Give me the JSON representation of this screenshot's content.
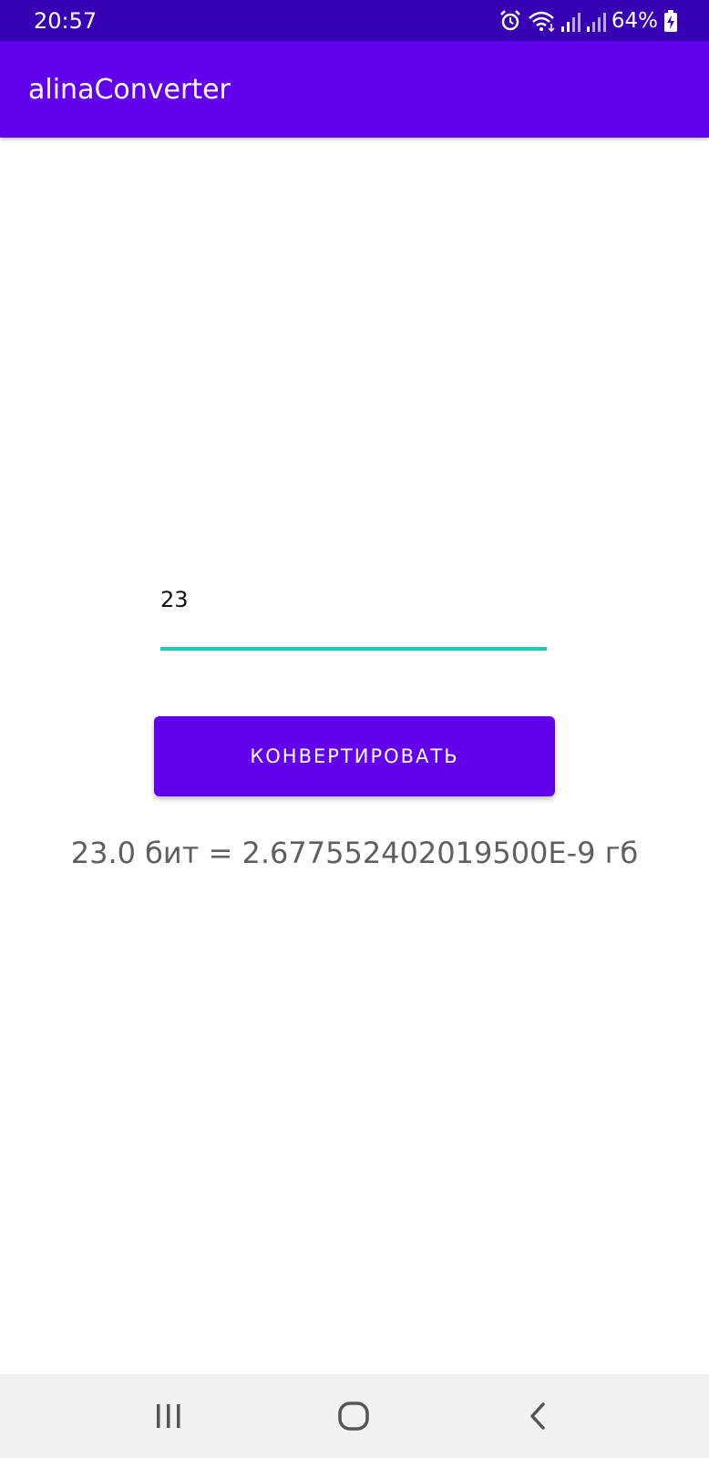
{
  "status_bar": {
    "time": "20:57",
    "battery": "64%",
    "icons": [
      "alarm-icon",
      "wifi-icon",
      "signal-icon",
      "signal-icon",
      "battery-charging-icon"
    ]
  },
  "app_bar": {
    "title": "alinaConverter"
  },
  "main": {
    "input_value": "23",
    "convert_label": "КОНВЕРТИРОВАТЬ",
    "result": "23.0 бит = 2.677552402019500Е-9 гб"
  },
  "nav_bar": {
    "icons": [
      "recent-apps-icon",
      "home-icon",
      "back-icon"
    ]
  },
  "colors": {
    "status_bar": "#3700b3",
    "primary": "#6200ee",
    "accent": "#26c6b8",
    "result_text": "#5f5f5f"
  }
}
